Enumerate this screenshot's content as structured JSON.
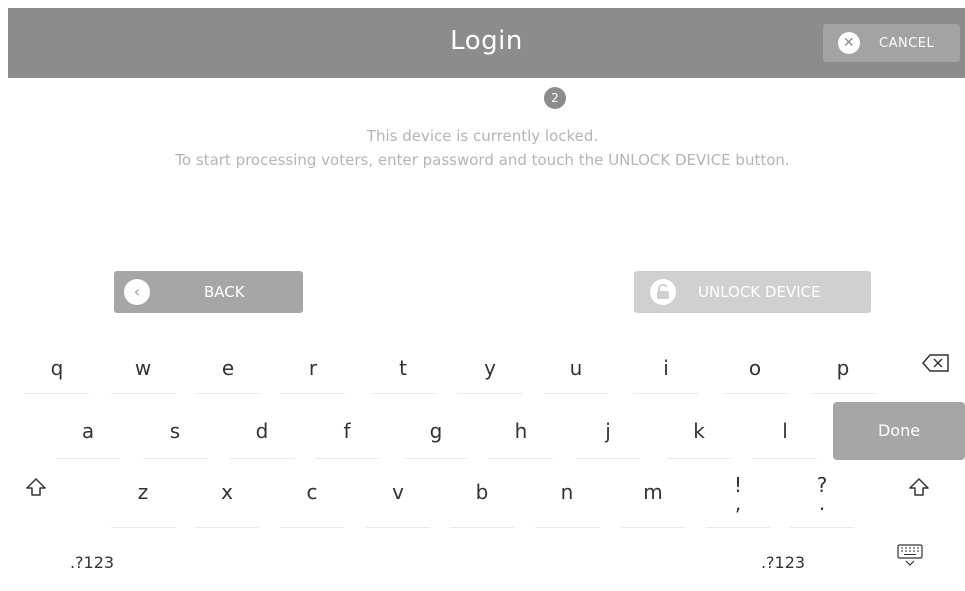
{
  "header": {
    "title": "Login",
    "cancel_label": "CANCEL",
    "cancel_icon": "close-icon"
  },
  "step": {
    "number": "2"
  },
  "message": {
    "line1": "This device is currently locked.",
    "line2": "To start processing voters, enter password and touch the UNLOCK DEVICE button."
  },
  "buttons": {
    "back_label": "BACK",
    "back_icon": "chevron-left-icon",
    "unlock_label": "UNLOCK DEVICE",
    "unlock_icon": "unlock-icon"
  },
  "keyboard": {
    "row1": [
      "q",
      "w",
      "e",
      "r",
      "t",
      "y",
      "u",
      "i",
      "o",
      "p"
    ],
    "row2": [
      "a",
      "s",
      "d",
      "f",
      "g",
      "h",
      "j",
      "k",
      "l"
    ],
    "row3": [
      "z",
      "x",
      "c",
      "v",
      "b",
      "n",
      "m"
    ],
    "row3_punct1": [
      "!",
      ","
    ],
    "row3_punct2": [
      "?",
      "."
    ],
    "numbers_left": ".?123",
    "numbers_right": ".?123",
    "done_label": "Done",
    "backspace_icon": "backspace-icon",
    "shift_icon": "shift-icon",
    "keyboard_dismiss_icon": "keyboard-dismiss-icon"
  },
  "colors": {
    "header_bg": "#8c8c8c",
    "button_bg": "#a6a6a6",
    "unlock_bg": "#d0d0d0",
    "message_text": "#b5b5b5"
  }
}
